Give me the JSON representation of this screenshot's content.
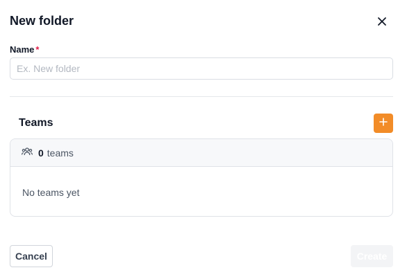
{
  "dialog": {
    "title": "New folder",
    "close_icon": "close-icon"
  },
  "name_field": {
    "label": "Name",
    "required_marker": "*",
    "value": "",
    "placeholder": "Ex. New folder"
  },
  "teams": {
    "title": "Teams",
    "add_icon": "plus-icon",
    "header_icon": "users-icon",
    "count": "0",
    "count_label": "teams",
    "empty_message": "No teams yet"
  },
  "footer": {
    "cancel_label": "Cancel",
    "create_label": "Create",
    "create_disabled": true
  },
  "colors": {
    "accent": "#f28c28",
    "required": "#e11d48",
    "disabled_button": "#f3f4f6"
  }
}
